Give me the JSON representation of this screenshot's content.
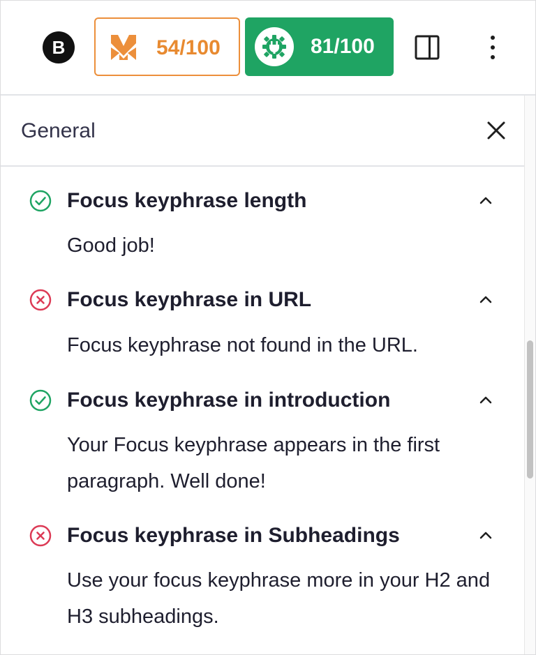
{
  "toolbar": {
    "brand_letter": "B",
    "score_primary": "54/100",
    "score_secondary": "81/100",
    "colors": {
      "orange": "#ec8f3b",
      "green": "#1fa463"
    }
  },
  "panel": {
    "title": "General"
  },
  "checks": [
    {
      "status": "good",
      "title": "Focus keyphrase length",
      "description": "Good job!"
    },
    {
      "status": "bad",
      "title": "Focus keyphrase in URL",
      "description": "Focus keyphrase not found in the URL."
    },
    {
      "status": "good",
      "title": "Focus keyphrase in introduction",
      "description": "Your Focus keyphrase appears in the first paragraph. Well done!"
    },
    {
      "status": "bad",
      "title": "Focus keyphrase in Subheadings",
      "description": "Use your focus keyphrase more in your H2 and H3 subheadings."
    }
  ],
  "icons": {
    "brand": "b-logo-icon",
    "primary_score": "m-logo-icon",
    "secondary_score": "gear-plug-icon",
    "sidebar": "sidebar-toggle-icon",
    "more": "more-vertical-icon",
    "close": "close-icon",
    "good": "check-circle-icon",
    "bad": "x-circle-icon",
    "collapse": "chevron-up-icon"
  }
}
